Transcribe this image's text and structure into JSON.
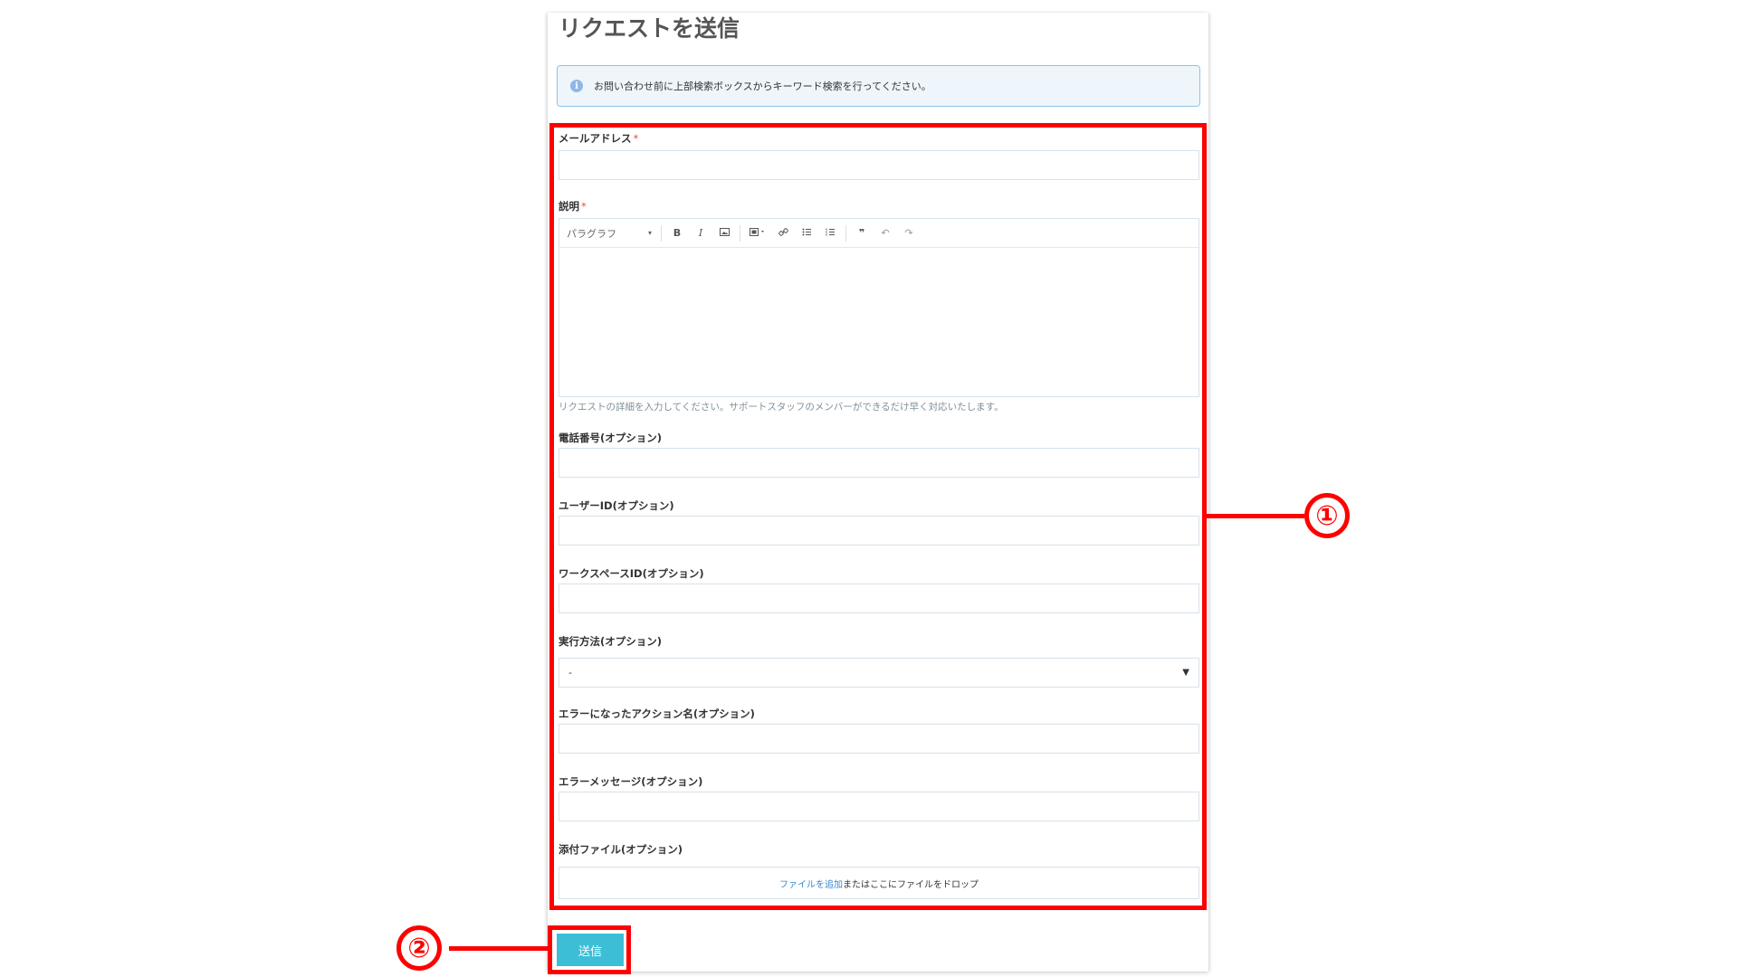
{
  "page": {
    "title": "リクエストを送信",
    "notice": "お問い合わせ前に上部検索ボックスからキーワード検索を行ってください。",
    "info_icon": "i"
  },
  "form": {
    "email_label": "メールアドレス",
    "required_mark": "*",
    "description_label": "説明",
    "editor": {
      "paragraph_select": "パラグラフ",
      "bold": "B",
      "italic": "I"
    },
    "description_help": "リクエストの詳細を入力してください。サポートスタッフのメンバーができるだけ早く対応いたします。",
    "phone_label": "電話番号(オプション)",
    "user_id_label": "ユーザーID(オプション)",
    "workspace_id_label": "ワークスペースID(オプション)",
    "exec_method_label": "実行方法(オプション)",
    "exec_method_value": "-",
    "error_action_label": "エラーになったアクション名(オプション)",
    "error_message_label": "エラーメッセージ(オプション)",
    "attachment_label": "添付ファイル(オプション)",
    "attachment_link": "ファイルを追加",
    "attachment_text": "またはここにファイルをドロップ",
    "submit_label": "送信"
  },
  "callouts": {
    "one": "①",
    "two": "②"
  },
  "colors": {
    "highlight": "#ff0000",
    "submit": "#3cbfd6",
    "notice_bg": "#eef6fc"
  }
}
